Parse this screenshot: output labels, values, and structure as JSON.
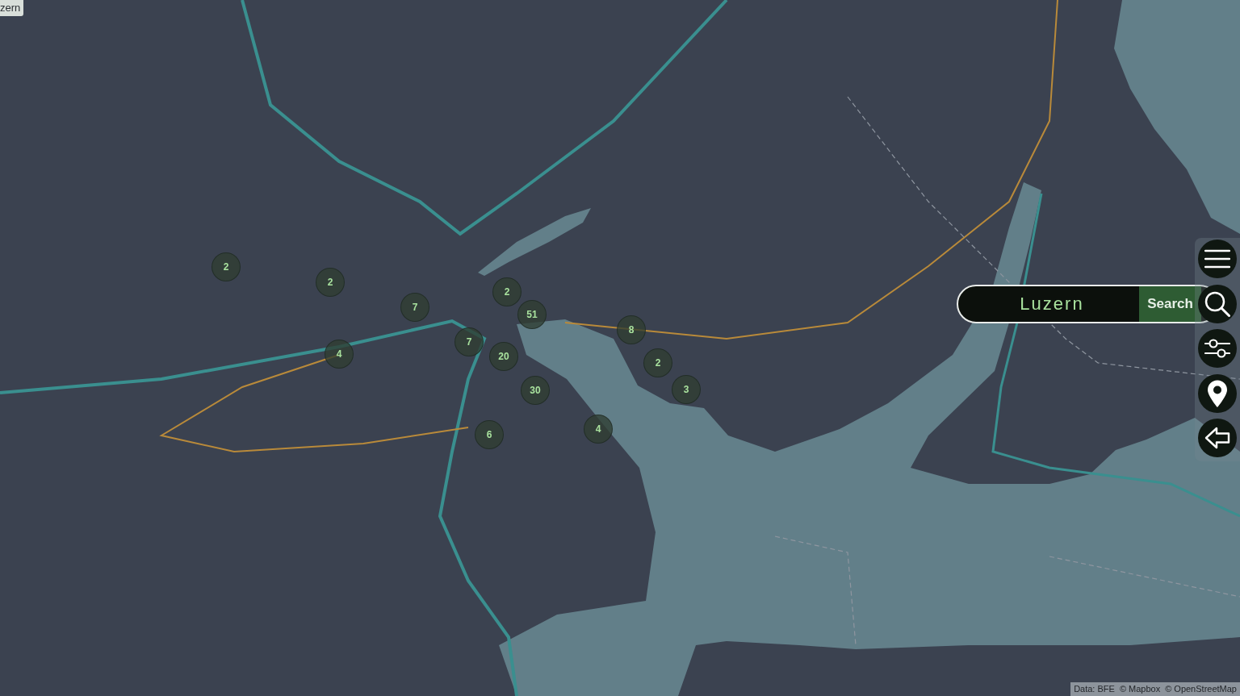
{
  "location_label": "zern",
  "clusters": [
    {
      "count": "2"
    },
    {
      "count": "2"
    },
    {
      "count": "2"
    },
    {
      "count": "7"
    },
    {
      "count": "51"
    },
    {
      "count": "8"
    },
    {
      "count": "7"
    },
    {
      "count": "4"
    },
    {
      "count": "20"
    },
    {
      "count": "2"
    },
    {
      "count": "30"
    },
    {
      "count": "3"
    },
    {
      "count": "4"
    },
    {
      "count": "6"
    }
  ],
  "search": {
    "value": "Luzern",
    "button": "Search"
  },
  "toolbar": [
    {
      "kind": "menu"
    },
    {
      "kind": "search"
    },
    {
      "kind": "filter"
    },
    {
      "kind": "location"
    },
    {
      "kind": "back"
    }
  ],
  "attribution": [
    "Data: BFE",
    "© Mapbox",
    "© OpenStreetMap"
  ]
}
